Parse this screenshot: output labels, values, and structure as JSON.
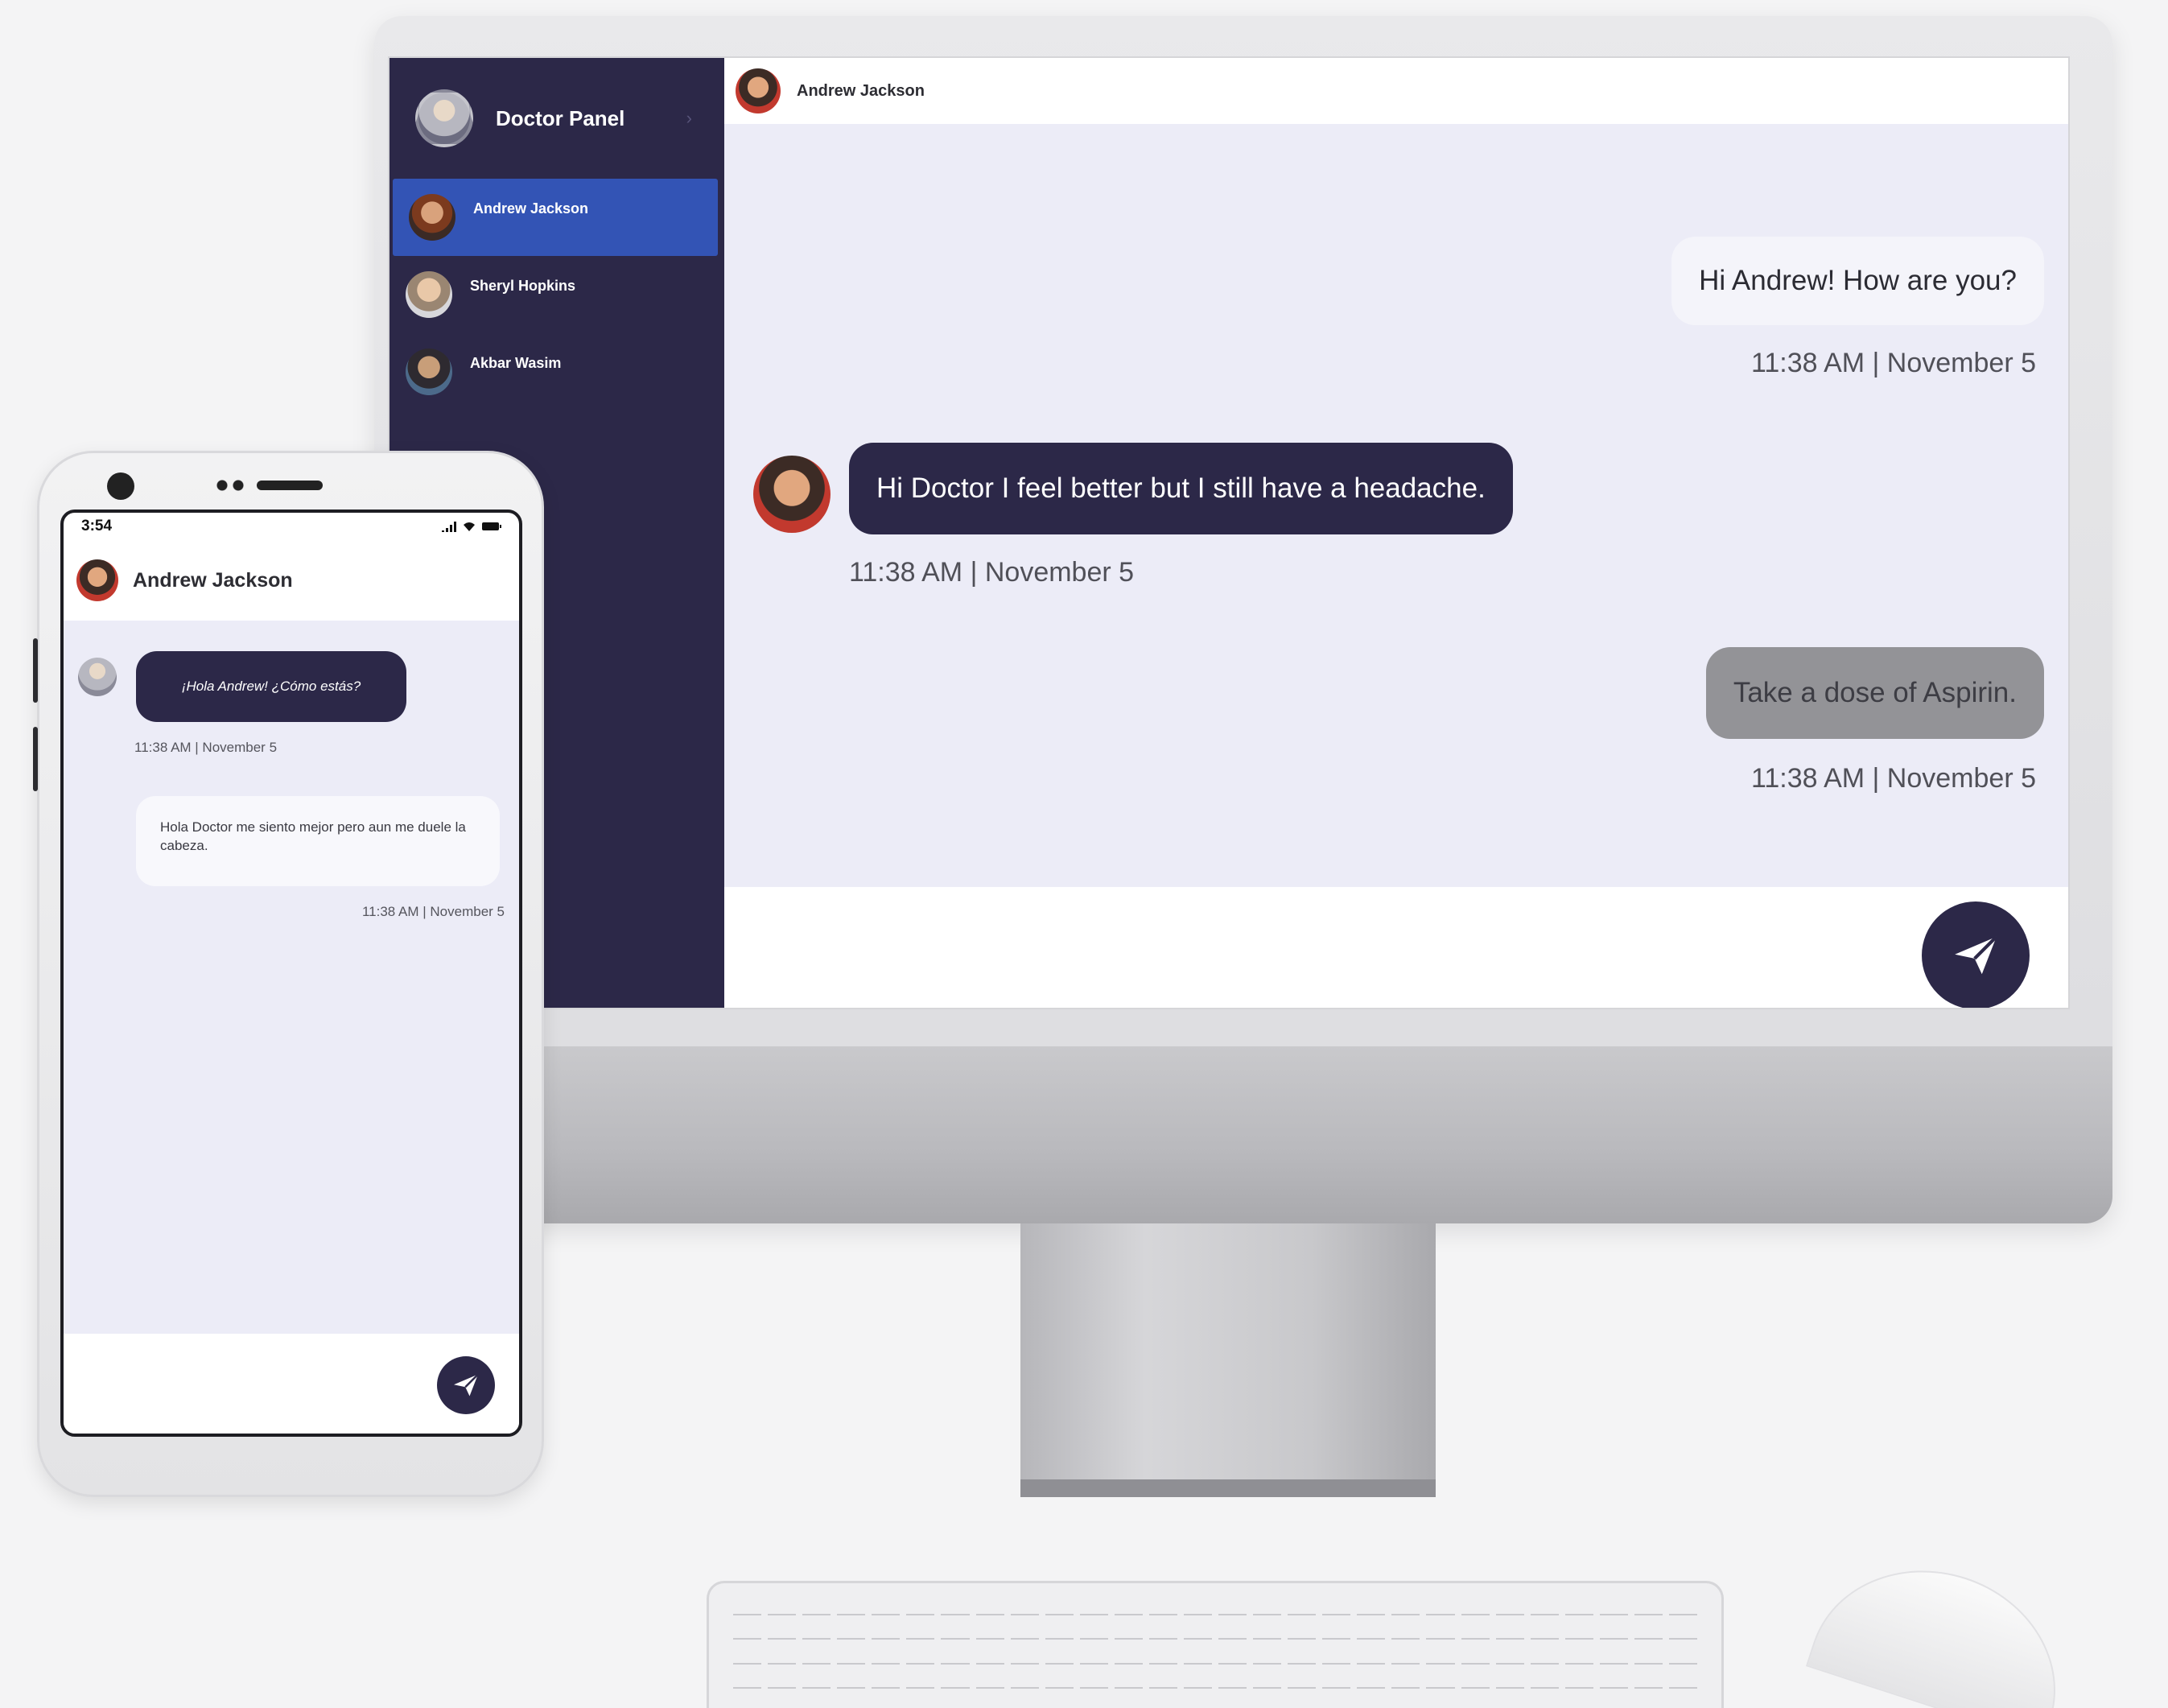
{
  "desktop": {
    "panel_title": "Doctor Panel",
    "contacts": [
      {
        "name": "Andrew Jackson",
        "active": true
      },
      {
        "name": "Sheryl Hopkins",
        "active": false
      },
      {
        "name": "Akbar Wasim",
        "active": false
      }
    ],
    "chat_header_name": "Andrew Jackson",
    "messages": [
      {
        "text": "Hi Andrew! How are you?",
        "time": "11:38 AM | November 5",
        "side": "right"
      },
      {
        "text": "Hi Doctor I feel better but I still have a headache.",
        "time": "11:38 AM | November 5",
        "side": "left"
      },
      {
        "text": "Take a dose of Aspirin.",
        "time": "11:38 AM | November 5",
        "side": "right"
      }
    ],
    "send_icon": "paper-plane-icon"
  },
  "mobile": {
    "status_time": "3:54",
    "chat_header_name": "Andrew Jackson",
    "messages": [
      {
        "text": "¡Hola Andrew! ¿Cómo estás?",
        "time": "11:38 AM | November 5"
      },
      {
        "text": "Hola Doctor me siento mejor pero aun me duele la cabeza.",
        "time": "11:38 AM | November 5"
      }
    ],
    "send_icon": "paper-plane-icon"
  },
  "colors": {
    "sidebar": "#2c2848",
    "active_contact": "#3354b5",
    "chat_background": "#ececf7",
    "doctor_bubble": "#2c2848",
    "gray_bubble": "#939397"
  }
}
